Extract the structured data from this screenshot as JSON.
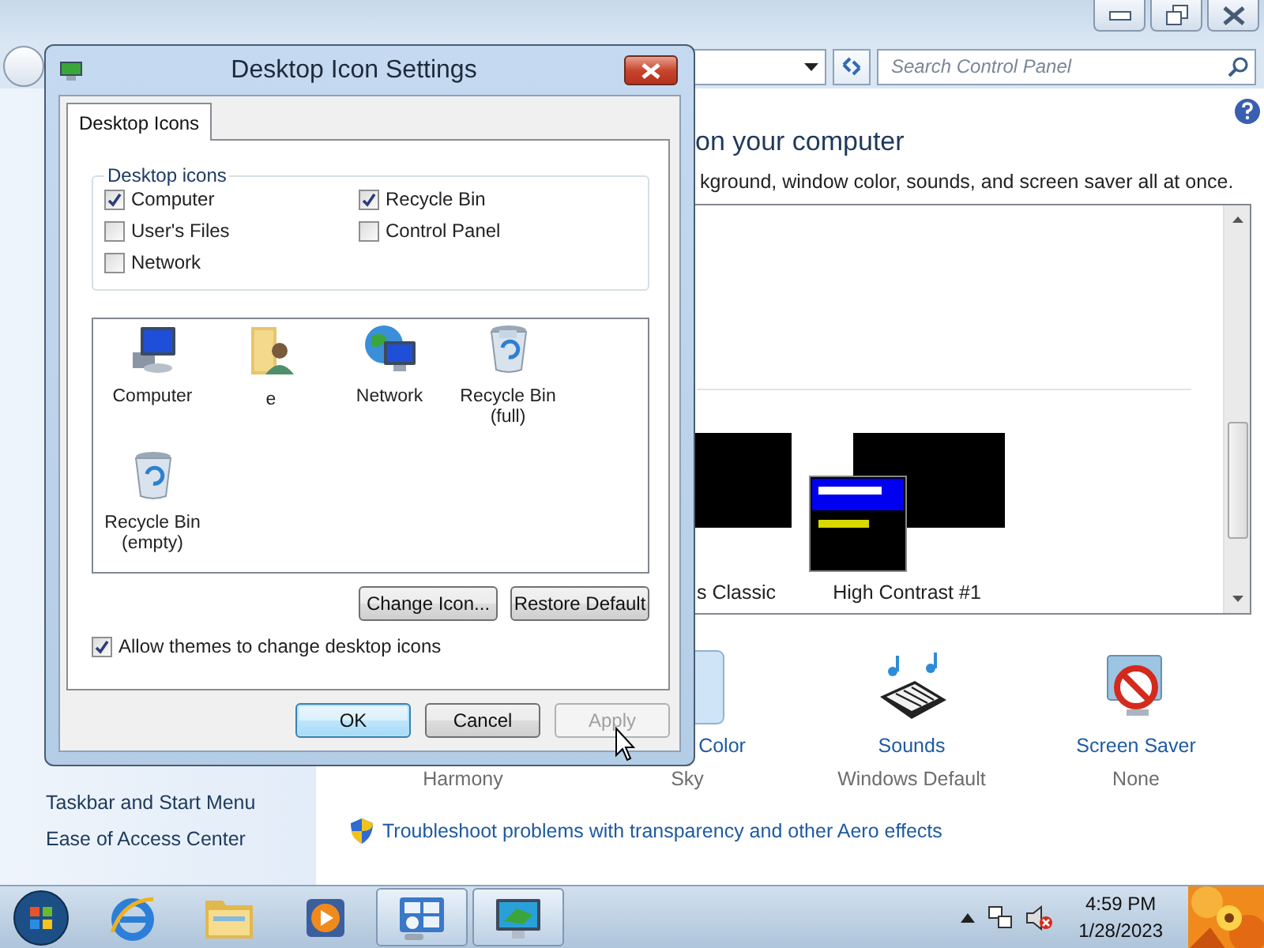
{
  "control_panel": {
    "search": {
      "placeholder": "Search Control Panel"
    },
    "heading": "on your computer",
    "description": "kground, window color, sounds, and screen saver all at once.",
    "themes": [
      {
        "label": "s Classic",
        "kind": "classic"
      },
      {
        "label": "High Contrast #1",
        "kind": "high-contrast"
      }
    ],
    "settings": [
      {
        "kind": "background",
        "value": "Harmony"
      },
      {
        "kind": "color",
        "label": "Color",
        "value": "Sky"
      },
      {
        "kind": "sounds",
        "label": "Sounds",
        "value": "Windows Default"
      },
      {
        "kind": "screensaver",
        "label": "Screen Saver",
        "value": "None"
      }
    ],
    "sidebar": [
      "Taskbar and Start Menu",
      "Ease of Access Center"
    ],
    "link": "Troubleshoot problems with transparency and other Aero effects"
  },
  "dialog": {
    "title": "Desktop Icon Settings",
    "tabs": [
      {
        "label": "Desktop Icons",
        "selected": true
      }
    ],
    "group_label": "Desktop icons",
    "checkboxes": [
      {
        "label": "Computer",
        "checked": true
      },
      {
        "label": "Recycle Bin",
        "checked": true
      },
      {
        "label": "User's Files",
        "checked": false
      },
      {
        "label": "Control Panel",
        "checked": false
      },
      {
        "label": "Network",
        "checked": false
      }
    ],
    "icons": [
      {
        "label": "Computer",
        "kind": "computer"
      },
      {
        "label": "e",
        "kind": "user"
      },
      {
        "label": "Network",
        "kind": "network"
      },
      {
        "label": "Recycle Bin (full)",
        "kind": "bin-full"
      },
      {
        "label": "Recycle Bin (empty)",
        "kind": "bin-empty"
      }
    ],
    "icon_buttons": [
      "Change Icon...",
      "Restore Default"
    ],
    "allow_themes": {
      "label": "Allow themes to change desktop icons",
      "checked": true
    },
    "buttons": [
      {
        "label": "OK",
        "default": true,
        "disabled": false
      },
      {
        "label": "Cancel",
        "default": false,
        "disabled": false
      },
      {
        "label": "Apply",
        "default": false,
        "disabled": true
      }
    ]
  },
  "taskbar": {
    "apps": [
      {
        "kind": "ie",
        "active": false
      },
      {
        "kind": "explorer",
        "active": false
      },
      {
        "kind": "media",
        "active": false
      },
      {
        "kind": "control-panel",
        "active": true
      },
      {
        "kind": "display",
        "active": true
      }
    ],
    "time": "4:59 PM",
    "date": "1/28/2023"
  }
}
